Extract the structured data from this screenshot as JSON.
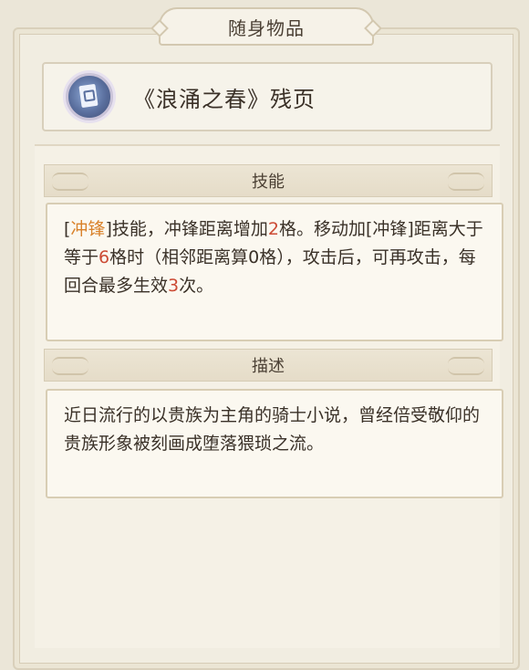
{
  "panel": {
    "title": "随身物品"
  },
  "item": {
    "icon": "book-page-icon",
    "name": "《浪涌之春》残页"
  },
  "skill": {
    "heading": "技能",
    "segments": [
      {
        "text": "[",
        "style": "normal"
      },
      {
        "text": "冲锋",
        "style": "orange"
      },
      {
        "text": "]技能，冲锋距离增加",
        "style": "normal"
      },
      {
        "text": "2",
        "style": "red"
      },
      {
        "text": "格。移动加[冲锋]距离大于等于",
        "style": "normal"
      },
      {
        "text": "6",
        "style": "red"
      },
      {
        "text": "格时（相邻距离算0格），攻击后，可再攻击，每回合最多生效",
        "style": "normal"
      },
      {
        "text": "3",
        "style": "red"
      },
      {
        "text": "次。",
        "style": "normal"
      }
    ]
  },
  "description": {
    "heading": "描述",
    "text": "近日流行的以贵族为主角的骑士小说，曾经倍受敬仰的贵族形象被刻画成堕落猥琐之流。"
  },
  "colors": {
    "highlight_orange": "#d9822b",
    "highlight_red": "#cc4b35"
  }
}
